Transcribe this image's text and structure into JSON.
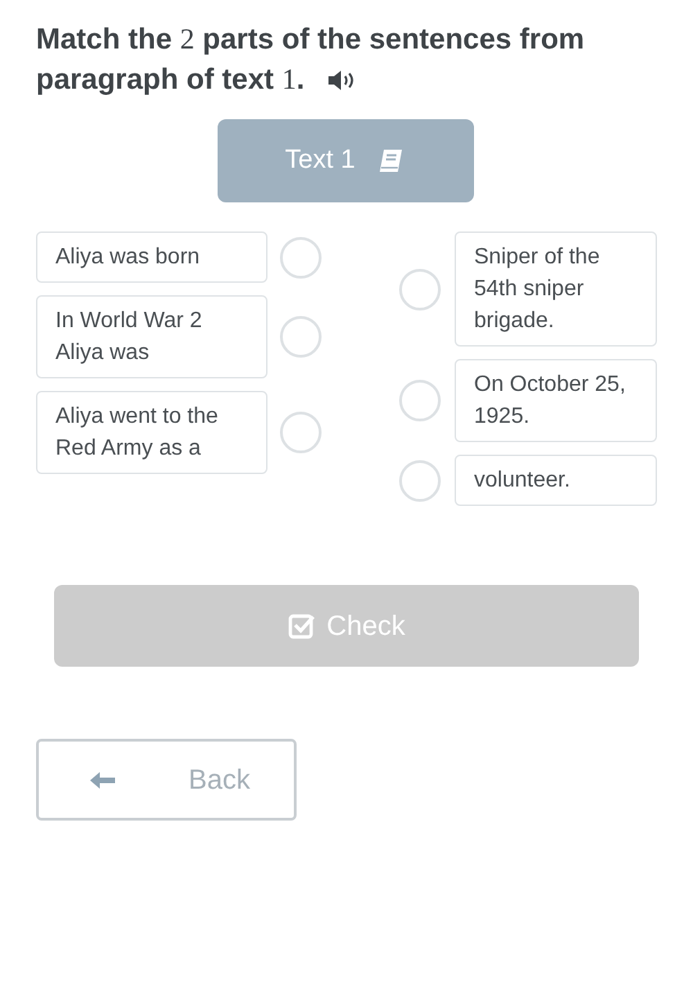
{
  "title": [
    {
      "kind": "text",
      "text": "Match the "
    },
    {
      "kind": "math",
      "text": "2"
    },
    {
      "kind": "text",
      "text": " parts of the sentences from paragraph of text "
    },
    {
      "kind": "math",
      "text": "1"
    },
    {
      "kind": "text",
      "text": "."
    }
  ],
  "text_button": {
    "label": "Text 1"
  },
  "left_items": [
    {
      "text": "Aliya was born",
      "selected": false
    },
    {
      "text": "In World War 2 Aliya was",
      "selected": false
    },
    {
      "text": "Aliya went to the Red Army as a",
      "selected": false
    }
  ],
  "right_items": [
    {
      "text": "Sniper of the 54th sniper brigade.",
      "selected": false
    },
    {
      "text": "On October 25, 1925.",
      "selected": false
    },
    {
      "text": "volunteer.",
      "selected": false
    }
  ],
  "check_button": {
    "label": "Check",
    "disabled": true
  },
  "back_button": {
    "label": "Back"
  }
}
